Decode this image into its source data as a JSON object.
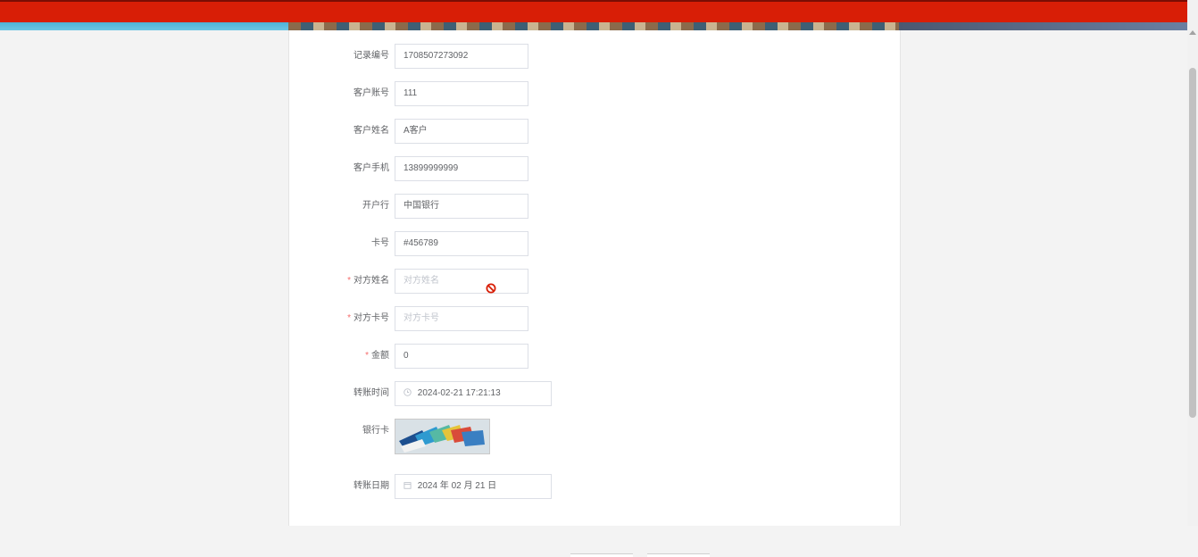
{
  "form": {
    "fields": [
      {
        "label": "记录编号",
        "value": "1708507273092"
      },
      {
        "label": "客户账号",
        "value": "111"
      },
      {
        "label": "客户姓名",
        "value": "A客户"
      },
      {
        "label": "客户手机",
        "value": "13899999999"
      },
      {
        "label": "开户行",
        "value": "中国银行"
      },
      {
        "label": "卡号",
        "value": "#456789"
      },
      {
        "label": "对方姓名",
        "required_mark": "*",
        "placeholder": "对方姓名"
      },
      {
        "label": "对方卡号",
        "required_mark": "*",
        "placeholder": "对方卡号"
      },
      {
        "label": "金额",
        "required_mark": "*",
        "value": "0"
      },
      {
        "label": "转账时间",
        "value": "2024-02-21 17:21:13",
        "icon": "clock-icon"
      },
      {
        "label": "银行卡",
        "image": "bank-cards-photo"
      },
      {
        "label": "转账日期",
        "value": "2024 年 02 月 21 日",
        "icon": "calendar-icon"
      }
    ]
  },
  "colors": {
    "top_bar": "#d81e06",
    "required": "#f56c6c",
    "forbid": "#d81e06"
  }
}
